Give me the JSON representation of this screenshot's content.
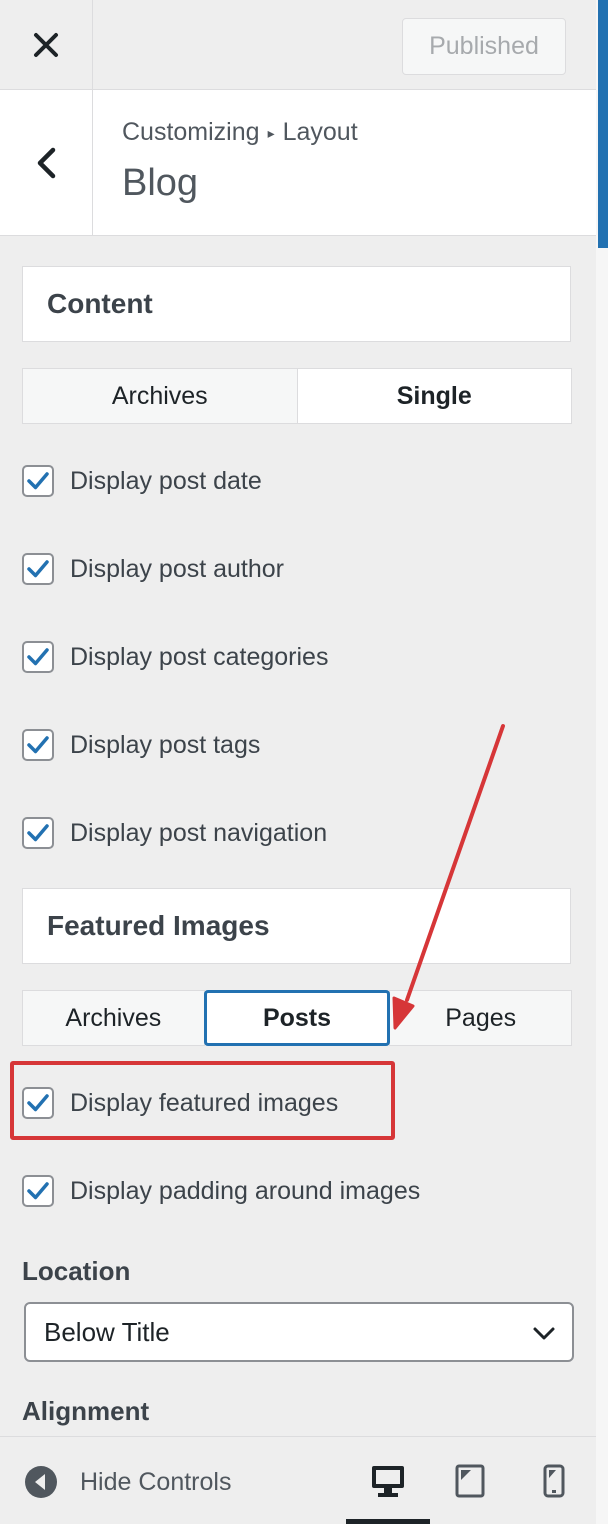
{
  "header": {
    "published_label": "Published",
    "breadcrumb_root": "Customizing",
    "breadcrumb_sep": "▸",
    "breadcrumb_current": "Layout",
    "section_title": "Blog"
  },
  "content": {
    "title": "Content",
    "tabs": [
      {
        "label": "Archives",
        "active": false
      },
      {
        "label": "Single",
        "active": true
      }
    ],
    "options": [
      {
        "label": "Display post date",
        "checked": true
      },
      {
        "label": "Display post author",
        "checked": true
      },
      {
        "label": "Display post categories",
        "checked": true
      },
      {
        "label": "Display post tags",
        "checked": true
      },
      {
        "label": "Display post navigation",
        "checked": true
      }
    ]
  },
  "featured": {
    "title": "Featured Images",
    "tabs": [
      {
        "label": "Archives",
        "active": false
      },
      {
        "label": "Posts",
        "active": true
      },
      {
        "label": "Pages",
        "active": false
      }
    ],
    "options": [
      {
        "label": "Display featured images",
        "checked": true
      },
      {
        "label": "Display padding around images",
        "checked": true
      }
    ],
    "location_label": "Location",
    "location_value": "Below Title",
    "alignment_label": "Alignment"
  },
  "footer": {
    "hide_controls_label": "Hide Controls",
    "active_device": "desktop"
  },
  "colors": {
    "accent": "#2271b1",
    "annotation": "#d63638",
    "checkmark": "#2271b1"
  },
  "icons": [
    "close-icon",
    "chevron-left-icon",
    "checkbox-check-icon",
    "chevron-down-icon",
    "collapse-arrow-icon",
    "desktop-icon",
    "tablet-icon",
    "mobile-icon"
  ]
}
